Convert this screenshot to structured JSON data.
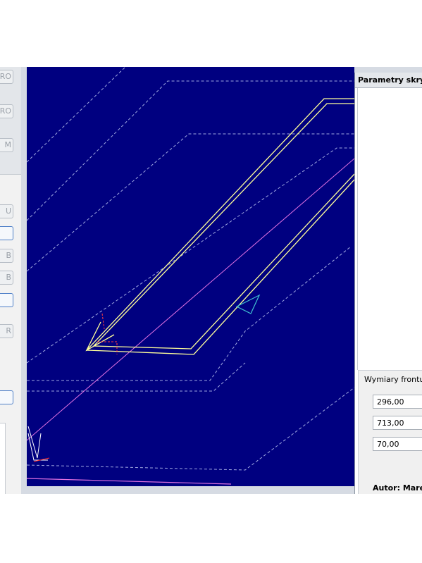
{
  "left_panel": {
    "buttons": [
      {
        "label": "RO"
      },
      {
        "label": "RO"
      },
      {
        "label": "M"
      },
      {
        "label": "U"
      },
      {
        "label": ""
      },
      {
        "label": "B"
      },
      {
        "label": "B"
      },
      {
        "label": ""
      },
      {
        "label": "R"
      },
      {
        "label": ""
      }
    ]
  },
  "viewport": {
    "background": "#000080",
    "colors": {
      "outline": "#ffff99",
      "dashed": "#a0a8e0",
      "diagonal": "#e070e0",
      "marker": "#40c0d0",
      "axis_x": "#ff3030"
    }
  },
  "params": {
    "title": "Parametry skryp",
    "front_group_title": "Wymiary frontu",
    "width_value": "296,00",
    "height_value": "713,00",
    "depth_value": "70,00",
    "author": "Autor: Marel"
  }
}
